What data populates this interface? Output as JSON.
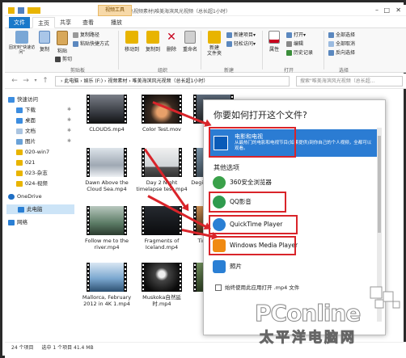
{
  "window": {
    "context_tab": "视频工具",
    "title": "F:\\视频素材\\唯美海滨风光视频（总长超1小时）"
  },
  "tabs": {
    "file": "文件",
    "home": "主页",
    "share": "共享",
    "view": "查看",
    "play": "播放"
  },
  "ribbon": {
    "pin_quick": "固定到\"快速访问\"",
    "copy": "复制",
    "paste": "粘贴",
    "copy_path": "复制路径",
    "paste_shortcut": "粘贴快捷方式",
    "cut": "剪切",
    "clipboard_group": "剪贴板",
    "move_to": "移动到",
    "copy_to": "复制到",
    "delete": "删除",
    "rename": "重命名",
    "organize_group": "组织",
    "new_folder": "新建\n文件夹",
    "new_item": "新建项目▾",
    "easy_access": "轻松访问▾",
    "new_group": "新建",
    "properties": "属性",
    "open": "打开▾",
    "edit": "编辑",
    "history": "历史记录",
    "open_group": "打开",
    "select_all": "全部选择",
    "select_none": "全部取消",
    "invert": "反向选择",
    "select_group": "选择"
  },
  "address": {
    "path": "› 此电脑 › 娱乐 (F:) › 视频素材 › 唯美海滨风光视频（总长超1小时）",
    "search_placeholder": "搜索\"唯美海滨风光视频（总长超..."
  },
  "sidebar": {
    "items": [
      {
        "label": "快速访问",
        "icon": "star-icon"
      },
      {
        "label": "下载",
        "icon": "download-icon"
      },
      {
        "label": "桌面",
        "icon": "desktop-icon"
      },
      {
        "label": "文档",
        "icon": "document-icon"
      },
      {
        "label": "图片",
        "icon": "picture-icon"
      },
      {
        "label": "020-win7",
        "icon": "folder-icon"
      },
      {
        "label": "021",
        "icon": "folder-icon"
      },
      {
        "label": "023-杂志",
        "icon": "folder-icon"
      },
      {
        "label": "024-视频",
        "icon": "folder-icon"
      },
      {
        "label": "OneDrive",
        "icon": "cloud-icon"
      },
      {
        "label": "此电脑",
        "icon": "computer-icon"
      },
      {
        "label": "网络",
        "icon": "network-icon"
      }
    ]
  },
  "files": [
    {
      "name": "CLOUDS.mp4"
    },
    {
      "name": "Color Test.mov"
    },
    {
      "name": "Coqu..."
    },
    {
      "name": "Dawn Above the Cloud Sea.mp4"
    },
    {
      "name": "Day 2 Night timelapse test.mp4"
    },
    {
      "name": "Degih Rac... Vide"
    },
    {
      "name": "Follow me to the river.mp4"
    },
    {
      "name": "Fragments of Iceland.mp4"
    },
    {
      "name": "Tim... sunse"
    },
    {
      "name": "Mallorca, February 2012 in 4K 1.mp4"
    },
    {
      "name": "Muskoka自然延时.mp4"
    },
    {
      "name": "My Gard"
    }
  ],
  "status": {
    "count": "24 个项目",
    "selected": "选中 1 个项目  41.4 MB"
  },
  "dialog": {
    "title": "你要如何打开这个文件?",
    "recommended_name": "电影和电视",
    "recommended_desc": "从最热门的电影和电视节目(如果提供)到你自己的个人视频，全都可以观看。",
    "other_label": "其他选项",
    "apps": [
      "360安全浏览器",
      "QQ影音",
      "QuickTime Player",
      "Windows Media Player",
      "照片"
    ],
    "always_use": "始终使用此应用打开 .mp4 文件"
  },
  "watermark": {
    "brand": "PConline",
    "sub": "太平洋电脑网"
  },
  "colors": {
    "accent": "#1979ca",
    "highlight": "#d9242a",
    "recommended_bg": "#2b7cd3"
  }
}
